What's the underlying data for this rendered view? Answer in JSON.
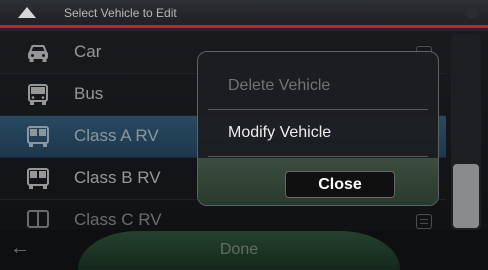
{
  "header": {
    "title": "Select Vehicle to Edit",
    "icon": "up-arrow-icon"
  },
  "vehicles": [
    {
      "label": "Car",
      "icon": "car-icon"
    },
    {
      "label": "Bus",
      "icon": "bus-icon"
    },
    {
      "label": "Class A RV",
      "icon": "rv-icon",
      "selected": true
    },
    {
      "label": "Class B RV",
      "icon": "rv-icon"
    },
    {
      "label": "Class C RV",
      "icon": "rv-icon"
    }
  ],
  "dialog": {
    "delete_label": "Delete Vehicle",
    "modify_label": "Modify Vehicle",
    "close_label": "Close"
  },
  "footer": {
    "done_label": "Done",
    "back_icon": "left-arrow-icon"
  },
  "colors": {
    "header_accent": "#c2251f",
    "selected_row": "#3a6a8c",
    "done_button": "#345e43"
  }
}
